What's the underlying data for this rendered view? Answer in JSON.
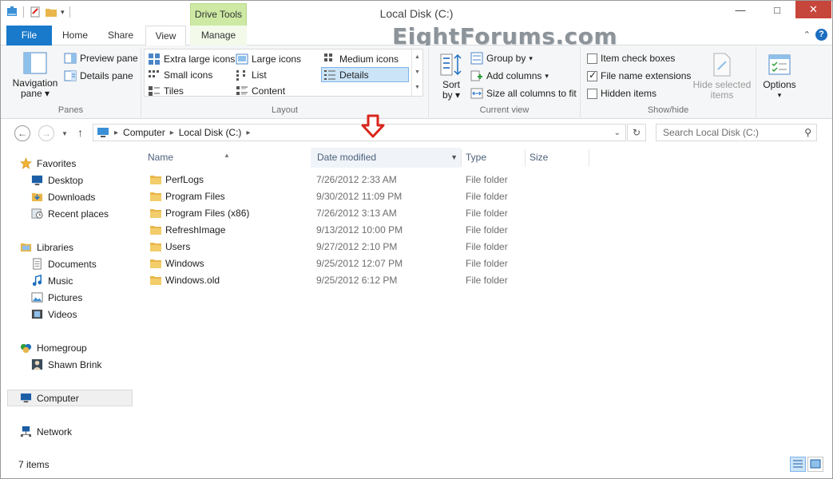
{
  "window": {
    "title": "Local Disk (C:)",
    "context_tab": "Drive Tools",
    "watermark": "EightForums.com"
  },
  "tabs": [
    {
      "label": "File"
    },
    {
      "label": "Home"
    },
    {
      "label": "Share"
    },
    {
      "label": "View"
    },
    {
      "label": "Manage"
    }
  ],
  "ribbon": {
    "panes": {
      "navigation_pane": "Navigation",
      "navigation_pane_2": "pane",
      "preview_pane": "Preview pane",
      "details_pane": "Details pane",
      "label": "Panes"
    },
    "layout": {
      "items": [
        "Extra large icons",
        "Large icons",
        "Medium icons",
        "Small icons",
        "List",
        "Details",
        "Tiles",
        "Content"
      ],
      "label": "Layout"
    },
    "current_view": {
      "sort_by": "Sort",
      "sort_by_2": "by",
      "group_by": "Group by",
      "add_columns": "Add columns",
      "size_columns": "Size all columns to fit",
      "label": "Current view"
    },
    "show_hide": {
      "item_check_boxes": "Item check boxes",
      "file_name_extensions": "File name extensions",
      "hidden_items": "Hidden items",
      "hide_selected": "Hide selected",
      "hide_selected_2": "items",
      "label": "Show/hide",
      "checked": {
        "item_check_boxes": false,
        "file_name_extensions": true,
        "hidden_items": false
      }
    },
    "options": "Options"
  },
  "address": {
    "parts": [
      "Computer",
      "Local Disk (C:)"
    ],
    "search_placeholder": "Search Local Disk (C:)"
  },
  "nav": {
    "favorites": "Favorites",
    "desktop": "Desktop",
    "downloads": "Downloads",
    "recent_places": "Recent places",
    "libraries": "Libraries",
    "documents": "Documents",
    "music": "Music",
    "pictures": "Pictures",
    "videos": "Videos",
    "homegroup": "Homegroup",
    "user": "Shawn Brink",
    "computer": "Computer",
    "network": "Network"
  },
  "columns": {
    "name": "Name",
    "date": "Date modified",
    "type": "Type",
    "size": "Size"
  },
  "files": [
    {
      "name": "PerfLogs",
      "date": "7/26/2012 2:33 AM",
      "type": "File folder"
    },
    {
      "name": "Program Files",
      "date": "9/30/2012 11:09 PM",
      "type": "File folder"
    },
    {
      "name": "Program Files (x86)",
      "date": "7/26/2012 3:13 AM",
      "type": "File folder"
    },
    {
      "name": "RefreshImage",
      "date": "9/13/2012 10:00 PM",
      "type": "File folder"
    },
    {
      "name": "Users",
      "date": "9/27/2012 2:10 PM",
      "type": "File folder"
    },
    {
      "name": "Windows",
      "date": "9/25/2012 12:07 PM",
      "type": "File folder"
    },
    {
      "name": "Windows.old",
      "date": "9/25/2012 6:12 PM",
      "type": "File folder"
    }
  ],
  "status": {
    "count": "7 items"
  },
  "colors": {
    "accent": "#1979ca",
    "context_tab": "#cde9a3",
    "close": "#c7463c",
    "folder": "#e8b64a",
    "arrow": "#d9261c"
  }
}
